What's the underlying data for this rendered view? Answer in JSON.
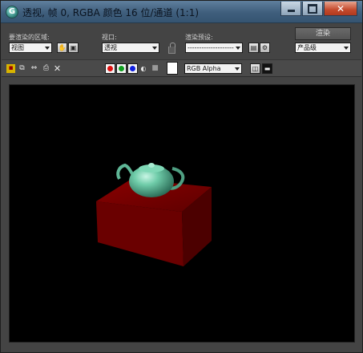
{
  "window": {
    "title": "透视, 帧 0, RGBA 颜色 16 位/通道 (1:1)",
    "app_icon_glyph": "G",
    "controls": {
      "minimize": "",
      "maximize": "",
      "close": "✕"
    }
  },
  "render_area": {
    "label": "要渲染的区域:",
    "value": "视图"
  },
  "viewport": {
    "label": "视口:",
    "value": "透视"
  },
  "render_preset": {
    "label": "渲染预设:",
    "value": "--------------------"
  },
  "render_button": {
    "label": "渲染"
  },
  "production": {
    "value": "产品级"
  },
  "toolbar": {
    "channels": [
      {
        "name": "red-channel",
        "color": "#e01010"
      },
      {
        "name": "green-channel",
        "color": "#10a020"
      },
      {
        "name": "blue-channel",
        "color": "#1020e0"
      }
    ],
    "display_channel": {
      "value": "RGB Alpha"
    }
  },
  "scene": {
    "background": "#000000",
    "box_color": "#7a0000",
    "teapot_color": "#6fcca9"
  }
}
